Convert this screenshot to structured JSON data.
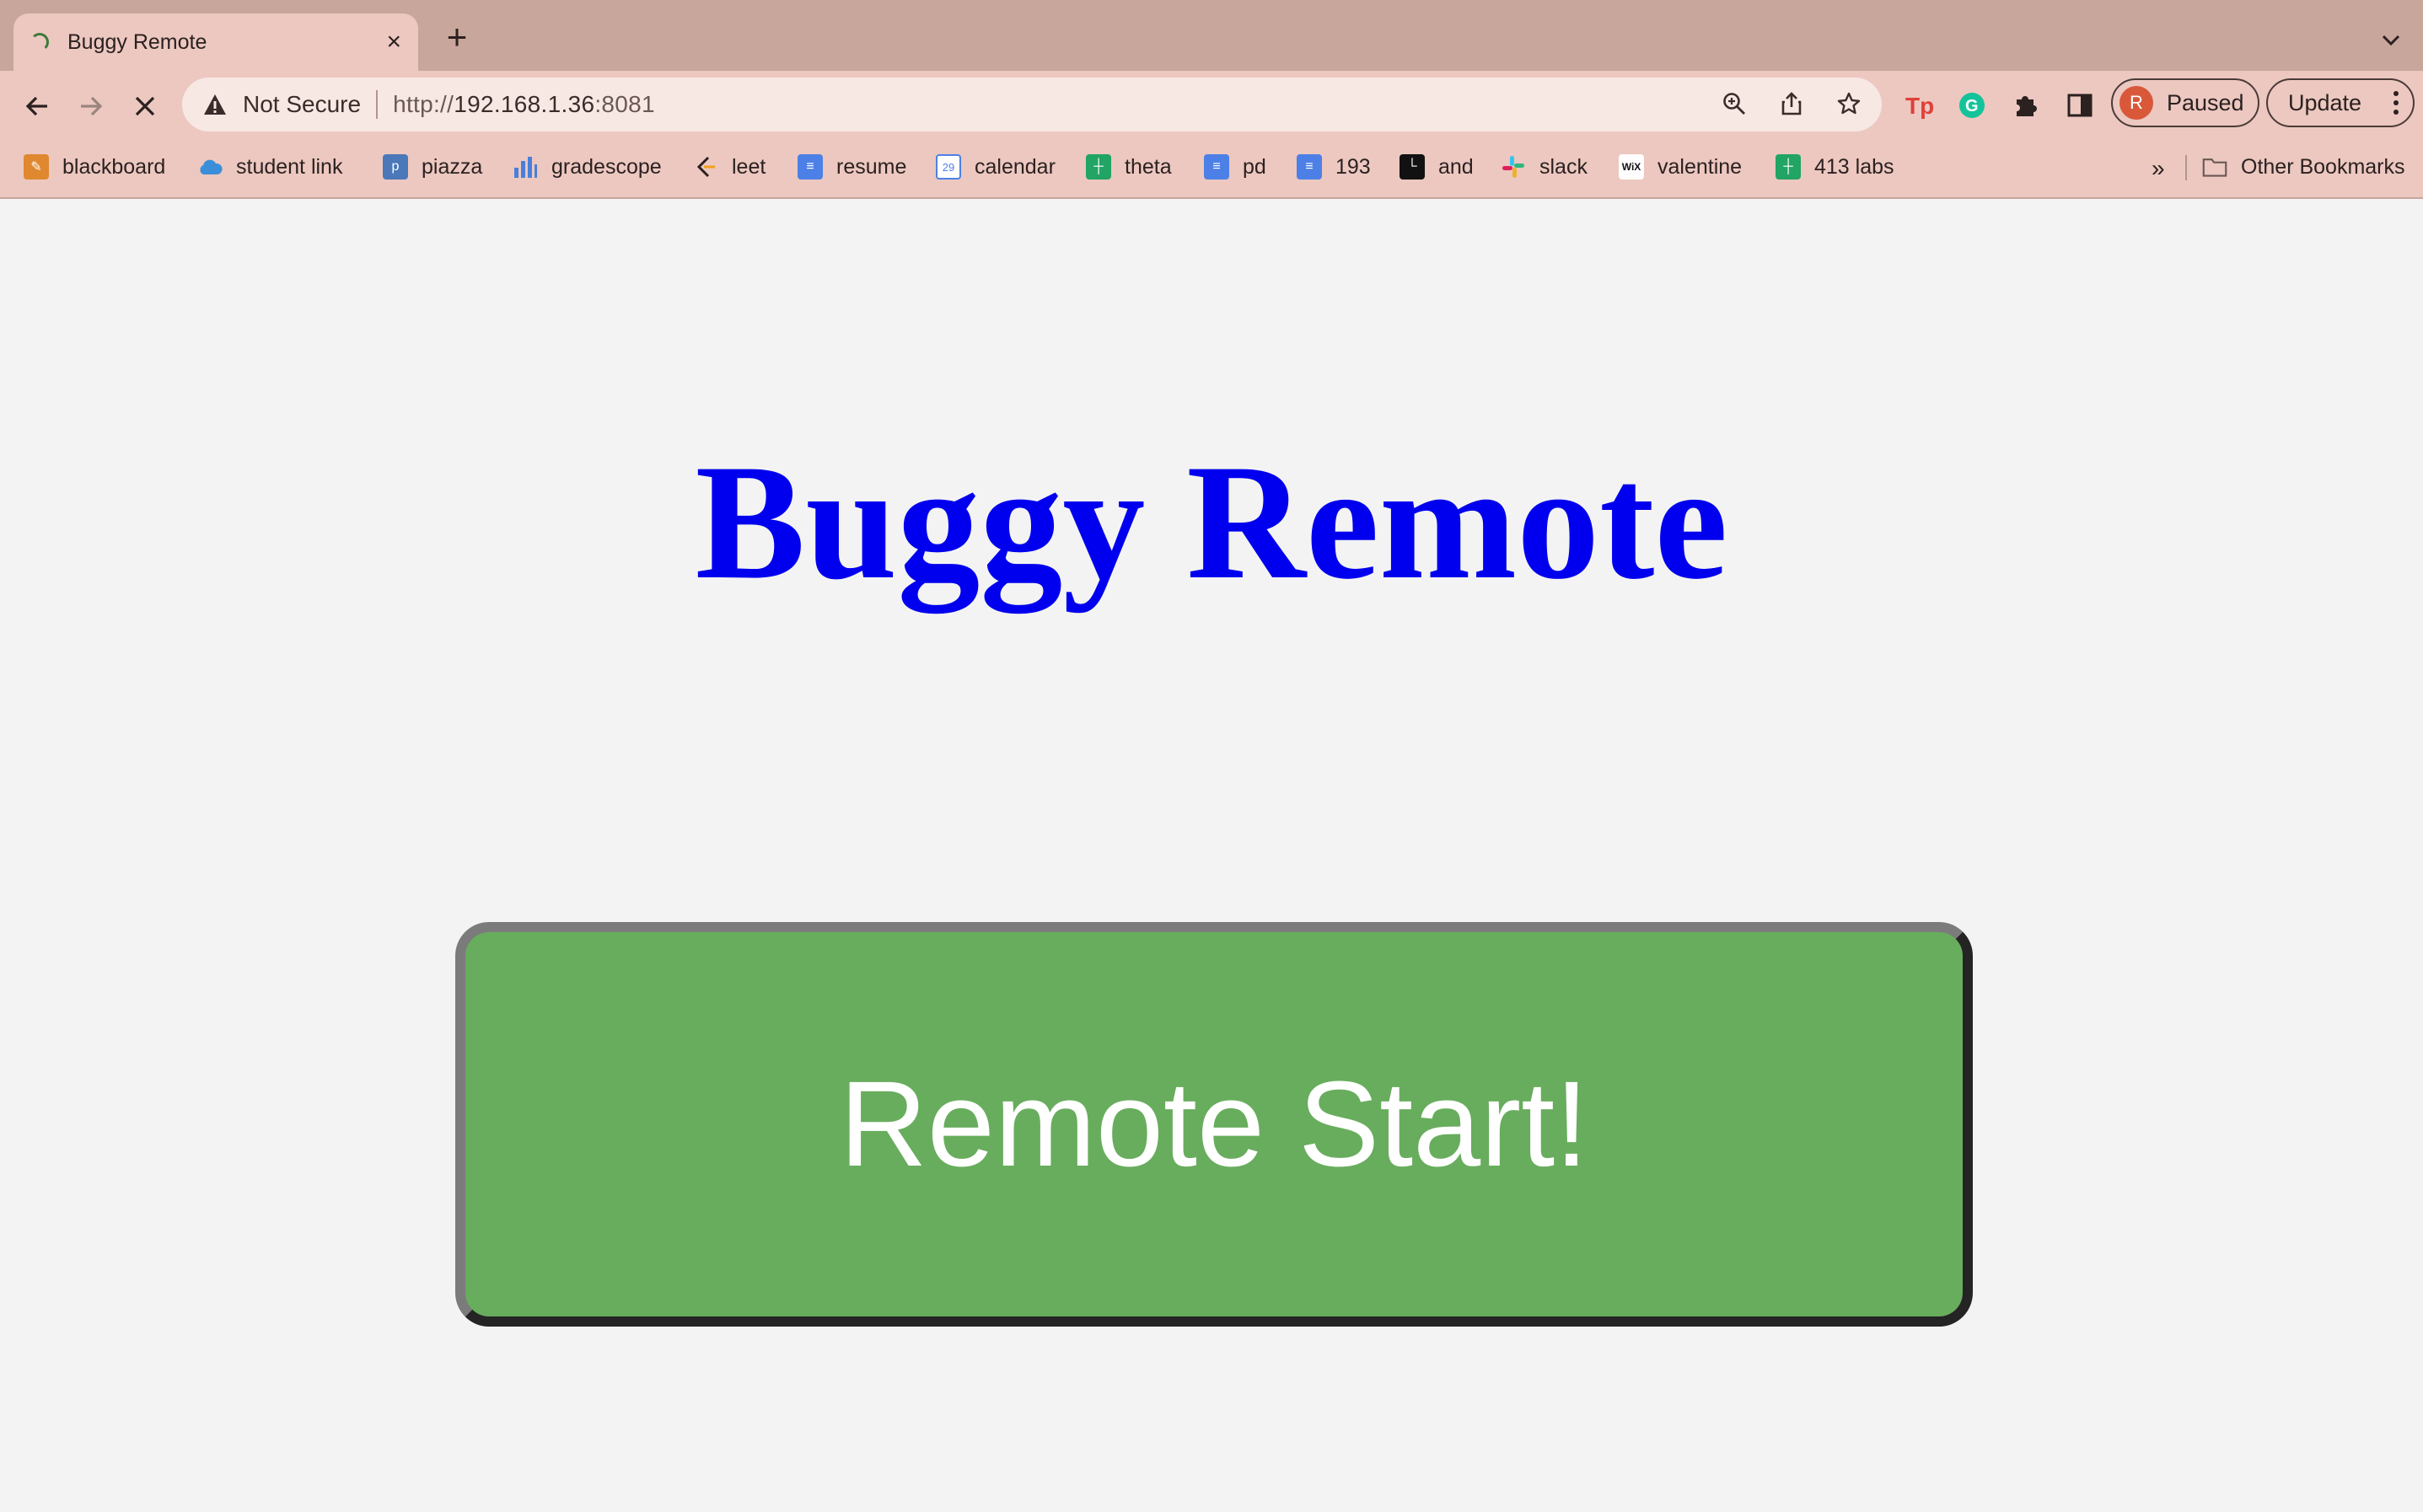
{
  "browser": {
    "tab_title": "Buggy Remote",
    "tab_close": "×",
    "new_tab": "+",
    "security_label": "Not Secure",
    "url_scheme": "http://",
    "url_host": "192.168.1.36",
    "url_port": ":8081",
    "profile_initial": "R",
    "profile_label": "Paused",
    "update_label": "Update",
    "bookmarks": [
      {
        "label": "blackboard",
        "icon": "blackboard-icon",
        "color": "#e0882f"
      },
      {
        "label": "student link",
        "icon": "cloud-icon",
        "color": "#3b8fd9"
      },
      {
        "label": "piazza",
        "icon": "piazza-icon",
        "color": "#4b78b8"
      },
      {
        "label": "gradescope",
        "icon": "bar-chart-icon",
        "color": "#4a7fd9"
      },
      {
        "label": "leet",
        "icon": "leetcode-icon",
        "color": "#f0a020"
      },
      {
        "label": "resume",
        "icon": "docs-icon",
        "color": "#4d80e6"
      },
      {
        "label": "calendar",
        "icon": "calendar-icon",
        "color": "#4d80e6"
      },
      {
        "label": "theta",
        "icon": "sheets-icon",
        "color": "#21a464"
      },
      {
        "label": "pd",
        "icon": "docs-icon",
        "color": "#4d80e6"
      },
      {
        "label": "193",
        "icon": "docs-icon",
        "color": "#4d80e6"
      },
      {
        "label": "and",
        "icon": "terminal-icon",
        "color": "#111111"
      },
      {
        "label": "slack",
        "icon": "slack-icon",
        "color": "#e01e5a"
      },
      {
        "label": "valentine",
        "icon": "wix-icon",
        "color": "#ffffff"
      },
      {
        "label": "413 labs",
        "icon": "sheets-icon",
        "color": "#21a464"
      }
    ],
    "bookmarks_overflow": "»",
    "other_bookmarks": "Other Bookmarks"
  },
  "page": {
    "heading": "Buggy Remote",
    "start_button": "Remote Start!"
  },
  "colors": {
    "heading": "#0000ee",
    "button_fill": "#68ad5d",
    "button_text": "#ffffff",
    "page_background": "#f3f3f3",
    "chrome_frame": "#c9a69b",
    "chrome_toolbar": "#ecc8c0"
  }
}
